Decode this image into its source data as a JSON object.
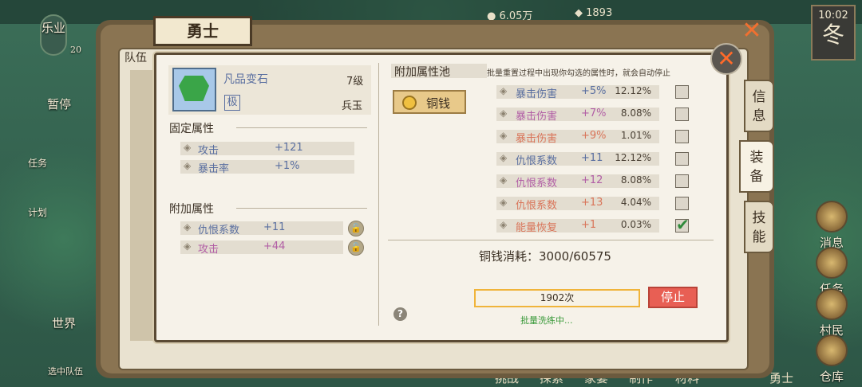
{
  "hud": {
    "coins": "6.05万",
    "gems": "1893",
    "time": "10:02",
    "season": "冬"
  },
  "left_nav": {
    "leye": "乐业",
    "leye_count": "20",
    "pause": "暂停",
    "task": "任务",
    "plan": "计划",
    "world": "世界",
    "team_select": "选中队伍"
  },
  "right_nav": {
    "news": "消息",
    "task": "任务",
    "villager": "村民",
    "storage": "仓库"
  },
  "bottom_nav": [
    "挑战",
    "探索",
    "家宴",
    "制作",
    "材料"
  ],
  "bottom_hero": "勇士",
  "panel": {
    "title": "勇士",
    "team_label": "队伍",
    "side_tabs": [
      "信息",
      "装备",
      "技能"
    ],
    "active_tab": "装备"
  },
  "item": {
    "name": "凡品变石",
    "level": "7级",
    "badge": "极",
    "kind": "兵玉"
  },
  "fixed_attrs": {
    "title": "固定属性",
    "rows": [
      {
        "name": "攻击",
        "value": "+121"
      },
      {
        "name": "暴击率",
        "value": "+1%"
      }
    ]
  },
  "extra_attrs": {
    "title": "附加属性",
    "rows": [
      {
        "name": "仇恨系数",
        "value": "+11"
      },
      {
        "name": "攻击",
        "value": "+44"
      }
    ]
  },
  "pool": {
    "title": "附加属性池",
    "hint": "批量重置过程中出现你勾选的属性时，就会自动停止",
    "currency_button": "铜钱",
    "rows": [
      {
        "name": "暴击伤害",
        "value": "+5%",
        "pct": "12.12%",
        "checked": false,
        "color": "#5a6fa0"
      },
      {
        "name": "暴击伤害",
        "value": "+7%",
        "pct": "8.08%",
        "checked": false,
        "color": "#b25fa6"
      },
      {
        "name": "暴击伤害",
        "value": "+9%",
        "pct": "1.01%",
        "checked": false,
        "color": "#d9755a"
      },
      {
        "name": "仇恨系数",
        "value": "+11",
        "pct": "12.12%",
        "checked": false,
        "color": "#5a6fa0"
      },
      {
        "name": "仇恨系数",
        "value": "+12",
        "pct": "8.08%",
        "checked": false,
        "color": "#b25fa6"
      },
      {
        "name": "仇恨系数",
        "value": "+13",
        "pct": "4.04%",
        "checked": false,
        "color": "#d9755a"
      },
      {
        "name": "能量恢复",
        "value": "+1",
        "pct": "0.03%",
        "checked": true,
        "color": "#d9755a"
      }
    ],
    "cost_label": "铜钱消耗：",
    "cost_value": "3000/60575",
    "count": "1902次",
    "stop_button": "停止",
    "status": "批量洗练中..."
  }
}
